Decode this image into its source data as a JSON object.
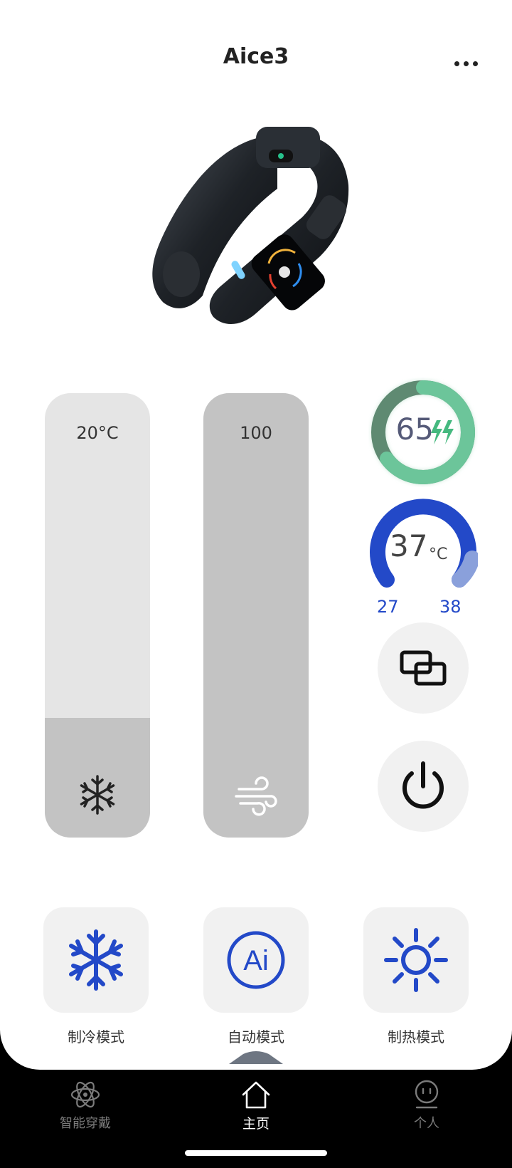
{
  "header": {
    "title": "Aice3",
    "more_icon": "more-horizontal-icon"
  },
  "device_image": {
    "icon": "neckband-device-image"
  },
  "sliders": {
    "temperature": {
      "value": "20°C",
      "fill_fraction": 0.27,
      "icon": "snowflake-icon"
    },
    "fan": {
      "value": "100",
      "fill_fraction": 1.0,
      "icon": "wind-icon"
    }
  },
  "battery": {
    "value": "65",
    "percent": 65,
    "icon": "charging-bolt-icon",
    "color": "#6cc59a"
  },
  "temperature_gauge": {
    "value": "37",
    "unit": "°C",
    "min": "27",
    "max": "38",
    "color": "#2349c8"
  },
  "buttons": {
    "switch": {
      "icon": "switch-screens-icon"
    },
    "power": {
      "icon": "power-icon"
    }
  },
  "modes": [
    {
      "label": "制冷模式",
      "icon": "snowflake-icon"
    },
    {
      "label": "自动模式",
      "icon": "ai-icon"
    },
    {
      "label": "制热模式",
      "icon": "sun-icon"
    }
  ],
  "tabbar": {
    "items": [
      {
        "label": "智能穿戴",
        "icon": "atom-icon",
        "active": false
      },
      {
        "label": "主页",
        "icon": "home-icon",
        "active": true
      },
      {
        "label": "个人",
        "icon": "person-icon",
        "active": false
      }
    ]
  },
  "colors": {
    "accent_blue": "#2349c8",
    "battery_green": "#6cc59a",
    "slider_track": "#e5e5e5",
    "slider_fill": "#c3c3c3"
  }
}
